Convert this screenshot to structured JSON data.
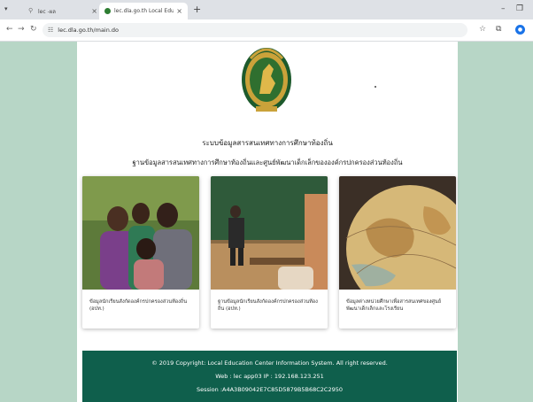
{
  "browser": {
    "tabs": [
      {
        "title": "lec -ผล",
        "active": false
      },
      {
        "title": "lec.dla.go.th Local Education C",
        "active": true
      }
    ],
    "url": "lec.dla.go.th/main.do"
  },
  "page": {
    "title_line1": "ระบบข้อมูลสารสนเทศทางการศึกษาท้องถิ่น",
    "title_line2": "ฐานข้อมูลสารสนเทศทางการศึกษาท้องถิ่นและศูนย์พัฒนาเด็กเล็กขององค์กรปกครองส่วนท้องถิ่น",
    "cards": [
      {
        "caption": "ข้อมูลนักเรียนสังกัดองค์กรปกครองส่วนท้องถิ่น (อปท.)"
      },
      {
        "caption": "ฐานข้อมูลนักเรียนสังกัดองค์กรปกครองส่วนท้องถิ่น (อปท.)"
      },
      {
        "caption": "ข้อมูลต่างหน่วยศึกษาเพื่อสารสนเทศของศูนย์พัฒนาเด็กเล็กและโรงเรียน"
      }
    ]
  },
  "footer": {
    "copyright": "© 2019 Copyright: Local Education Center Information System. All right reserved.",
    "web": "Web : lec app03 IP : 192.168.123.251",
    "session": "Session :A4A3B09042E7C85D5879B5B68C2C2950"
  },
  "colors": {
    "background": "#b7d6c6",
    "footer": "#0f5f4c"
  }
}
